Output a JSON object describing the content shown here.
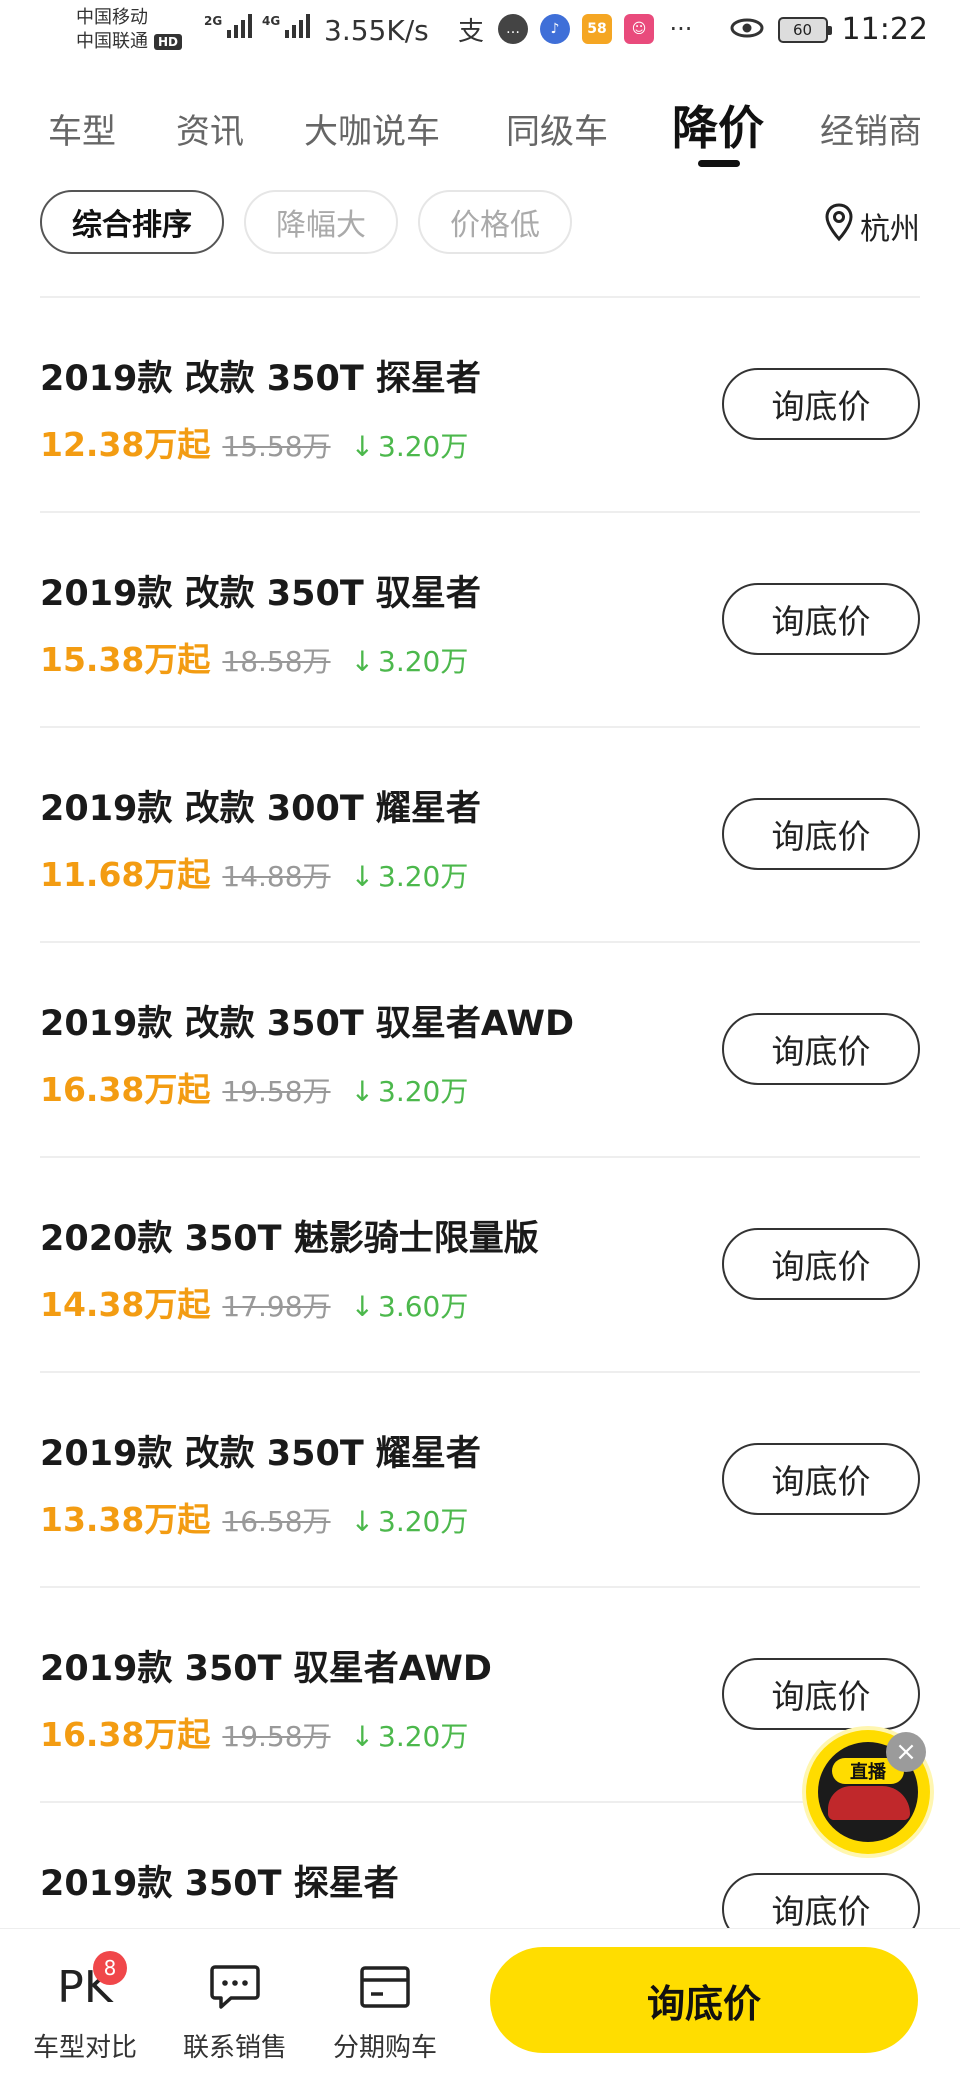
{
  "status_bar": {
    "carrier1": "中国移动",
    "carrier2": "中国联通",
    "hd": "HD",
    "net_tag1": "2G",
    "net_tag2": "4G",
    "net_speed": "3.55K/s",
    "battery": "60",
    "time": "11:22",
    "icons": [
      "alipay-icon",
      "chat-bubble-icon",
      "music-icon",
      "app-58-icon",
      "face-app-icon",
      "more-icon",
      "eye-icon"
    ]
  },
  "tabs": [
    {
      "label": "车型",
      "active": false
    },
    {
      "label": "资讯",
      "active": false
    },
    {
      "label": "大咖说车",
      "active": false
    },
    {
      "label": "同级车",
      "active": false
    },
    {
      "label": "降价",
      "active": true
    },
    {
      "label": "经销商",
      "active": false
    }
  ],
  "filters": {
    "chips": [
      {
        "label": "综合排序",
        "active": true
      },
      {
        "label": "降幅大",
        "active": false
      },
      {
        "label": "价格低",
        "active": false
      }
    ],
    "location": "杭州"
  },
  "list": [
    {
      "title": "2019款  改款 350T 探星者",
      "price": "12.38万起",
      "original": "15.58万",
      "drop": "3.20万",
      "button": "询底价"
    },
    {
      "title": "2019款 改款 350T 驭星者",
      "price": "15.38万起",
      "original": "18.58万",
      "drop": "3.20万",
      "button": "询底价"
    },
    {
      "title": "2019款 改款 300T 耀星者",
      "price": "11.68万起",
      "original": "14.88万",
      "drop": "3.20万",
      "button": "询底价"
    },
    {
      "title": "2019款 改款 350T 驭星者AWD",
      "price": "16.38万起",
      "original": "19.58万",
      "drop": "3.20万",
      "button": "询底价"
    },
    {
      "title": "2020款 350T 魅影骑士限量版",
      "price": "14.38万起",
      "original": "17.98万",
      "drop": "3.60万",
      "button": "询底价"
    },
    {
      "title": "2019款 改款 350T 耀星者",
      "price": "13.38万起",
      "original": "16.58万",
      "drop": "3.20万",
      "button": "询底价"
    },
    {
      "title": "2019款 350T 驭星者AWD",
      "price": "16.38万起",
      "original": "19.58万",
      "drop": "3.20万",
      "button": "询底价"
    },
    {
      "title": "2019款 350T 探星者",
      "price": "",
      "original": "",
      "drop": "",
      "button": "询底价"
    }
  ],
  "live": {
    "label": "直播"
  },
  "bottom_bar": {
    "pk_label": "车型对比",
    "pk_icon_text": "PK",
    "pk_badge": "8",
    "contact_label": "联系销售",
    "finance_label": "分期购车",
    "cta_label": "询底价"
  },
  "colors": {
    "accent_yellow": "#ffdd00",
    "price_orange": "#f39c12",
    "drop_green": "#4cb84c",
    "badge_red": "#f0474a"
  }
}
